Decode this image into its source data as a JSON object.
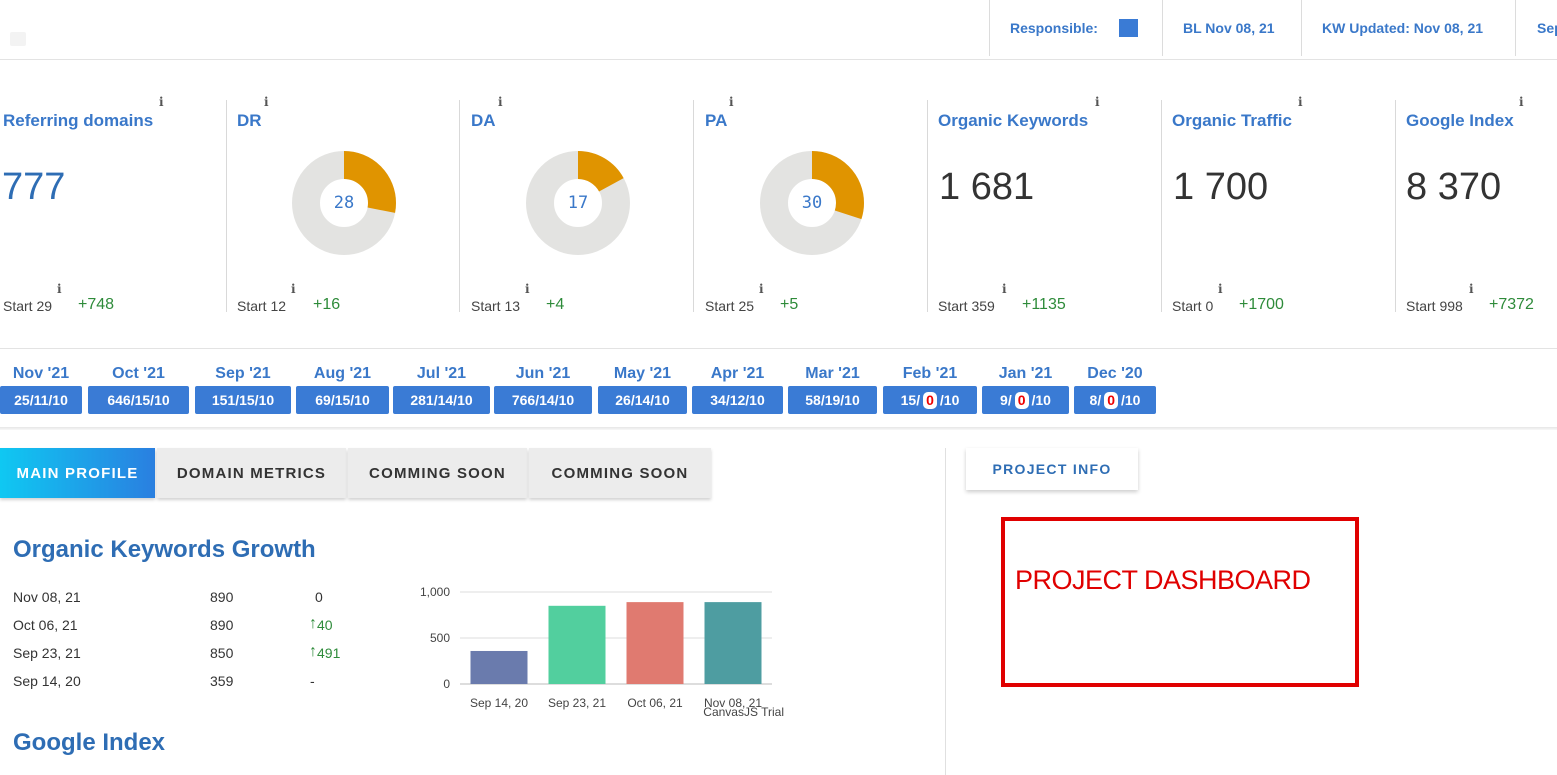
{
  "header": {
    "responsible_label": "Responsible:",
    "responsible_color": "#3a7bd5",
    "bl": "BL Nov 08, 21",
    "kw_updated": "KW Updated: Nov 08, 21",
    "next_cut": "Sep"
  },
  "metrics": [
    {
      "title": "Referring domains",
      "value": "777",
      "start": "Start 29",
      "delta": "+748"
    },
    {
      "title": "DR",
      "value": "28",
      "percent": 28,
      "start": "Start 12",
      "delta": "+16"
    },
    {
      "title": "DA",
      "value": "17",
      "percent": 17,
      "start": "Start 13",
      "delta": "+4"
    },
    {
      "title": "PA",
      "value": "30",
      "percent": 30,
      "start": "Start 25",
      "delta": "+5"
    },
    {
      "title": "Organic Keywords",
      "value": "1 681",
      "start": "Start 359",
      "delta": "+1135"
    },
    {
      "title": "Organic Traffic",
      "value": "1 700",
      "start": "Start 0",
      "delta": "+1700"
    },
    {
      "title": "Google Index",
      "value": "8 370",
      "start": "Start 998",
      "delta": "+7372"
    }
  ],
  "info_glyph": "i",
  "months": [
    {
      "label": "Nov '21",
      "a": "25",
      "b": "11",
      "c": "10"
    },
    {
      "label": "Oct '21",
      "a": "646",
      "b": "15",
      "c": "10"
    },
    {
      "label": "Sep '21",
      "a": "151",
      "b": "15",
      "c": "10"
    },
    {
      "label": "Aug '21",
      "a": "69",
      "b": "15",
      "c": "10"
    },
    {
      "label": "Jul '21",
      "a": "281",
      "b": "14",
      "c": "10"
    },
    {
      "label": "Jun '21",
      "a": "766",
      "b": "14",
      "c": "10"
    },
    {
      "label": "May '21",
      "a": "26",
      "b": "14",
      "c": "10"
    },
    {
      "label": "Apr '21",
      "a": "34",
      "b": "12",
      "c": "10"
    },
    {
      "label": "Mar '21",
      "a": "58",
      "b": "19",
      "c": "10"
    },
    {
      "label": "Feb '21",
      "a": "15",
      "b": "0",
      "c": "10"
    },
    {
      "label": "Jan '21",
      "a": "9",
      "b": "0",
      "c": "10"
    },
    {
      "label": "Dec '20",
      "a": "8",
      "b": "0",
      "c": "10"
    }
  ],
  "tabs": [
    "MAIN PROFILE",
    "DOMAIN METRICS",
    "COMMING SOON",
    "COMMING SOON"
  ],
  "project_tab": "PROJECT INFO",
  "project_dashboard": "PROJECT DASHBOARD",
  "keywords_growth": {
    "title": "Organic Keywords Growth",
    "rows": [
      {
        "date": "Nov 08, 21",
        "value": "890",
        "diff": "0",
        "up": false
      },
      {
        "date": "Oct 06, 21",
        "value": "890",
        "diff": "40",
        "up": true
      },
      {
        "date": "Sep 23, 21",
        "value": "850",
        "diff": "491",
        "up": true
      },
      {
        "date": "Sep 14, 20",
        "value": "359",
        "diff": "-",
        "up": false
      }
    ],
    "up_arrow": "↑"
  },
  "google_index_title": "Google Index",
  "chart_data": {
    "type": "bar",
    "categories": [
      "Sep 14, 20",
      "Sep 23, 21",
      "Oct 06, 21",
      "Nov 08, 21"
    ],
    "values": [
      359,
      850,
      890,
      890
    ],
    "colors": [
      "#6a7bad",
      "#52cf9e",
      "#e07a70",
      "#4e9da1"
    ],
    "ylim": [
      0,
      1000
    ],
    "yticks": [
      "0",
      "500",
      "1,000"
    ],
    "watermark": "CanvasJS Trial"
  }
}
